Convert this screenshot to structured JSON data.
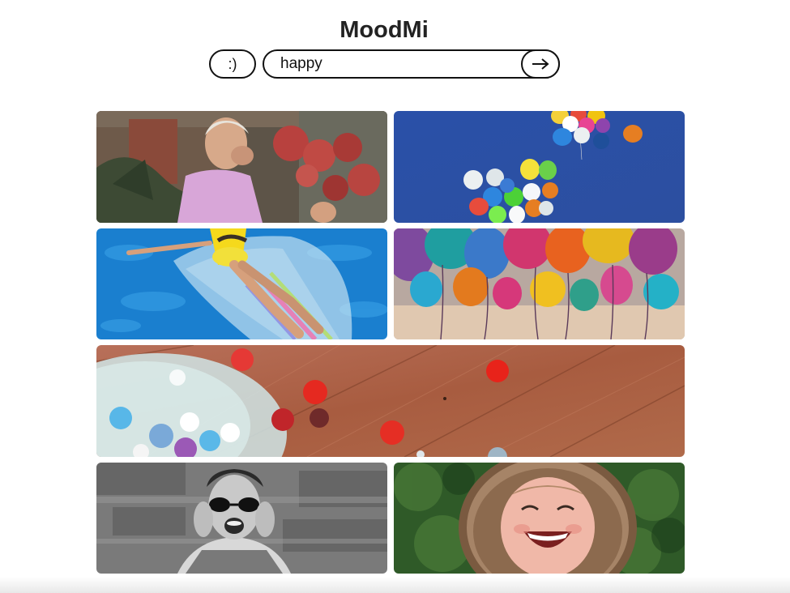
{
  "app": {
    "title": "MoodMi"
  },
  "search": {
    "mood_button_label": ":)",
    "query": "happy",
    "go_icon": "arrow-right-icon"
  },
  "gallery": {
    "images": [
      {
        "name": "laughing-elderly-woman-with-flowers"
      },
      {
        "name": "balloons-in-blue-sky"
      },
      {
        "name": "woman-on-pool-float"
      },
      {
        "name": "colorful-balloons-ribbons"
      },
      {
        "name": "confetti-balloon-on-wood"
      },
      {
        "name": "woman-in-sunglasses-laughing"
      },
      {
        "name": "laughing-child-fur-hood"
      }
    ]
  }
}
